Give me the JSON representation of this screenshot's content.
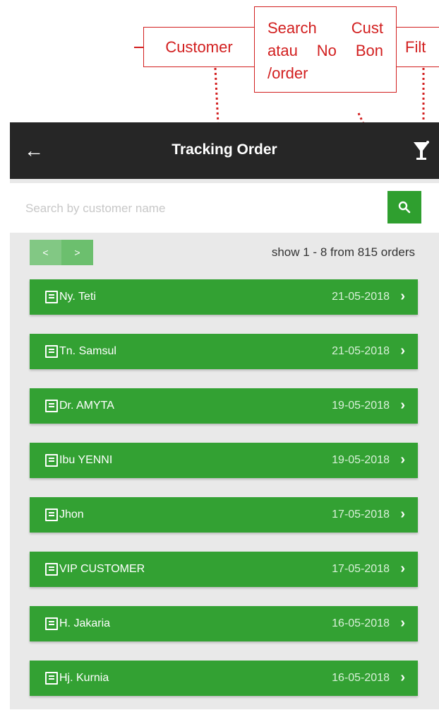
{
  "annotations": {
    "customer": "Customer",
    "search_line1a": "Search",
    "search_line1b": "Cust",
    "search_line2a": "atau",
    "search_line2b": "No",
    "search_line2c": "Bon",
    "search_line3": "/order",
    "filter": "Filt"
  },
  "appbar": {
    "back_icon": "←",
    "title": "Tracking Order",
    "filter_icon": "filter-icon"
  },
  "search": {
    "placeholder": "Search by customer name",
    "button_icon": "search-icon"
  },
  "pager": {
    "prev": "<",
    "next": ">"
  },
  "count_text": "show 1 - 8 from 815 orders",
  "orders": [
    {
      "name": "Ny. Teti",
      "date": "21-05-2018"
    },
    {
      "name": "Tn. Samsul",
      "date": "21-05-2018"
    },
    {
      "name": "Dr. AMYTA",
      "date": "19-05-2018"
    },
    {
      "name": "Ibu YENNI",
      "date": "19-05-2018"
    },
    {
      "name": "Jhon",
      "date": "17-05-2018"
    },
    {
      "name": "VIP CUSTOMER",
      "date": "17-05-2018"
    },
    {
      "name": "H. Jakaria",
      "date": "16-05-2018"
    },
    {
      "name": "Hj. Kurnia",
      "date": "16-05-2018"
    }
  ],
  "colors": {
    "green": "#33a133",
    "annotation_red": "#d21f1f",
    "appbar": "#262626"
  }
}
